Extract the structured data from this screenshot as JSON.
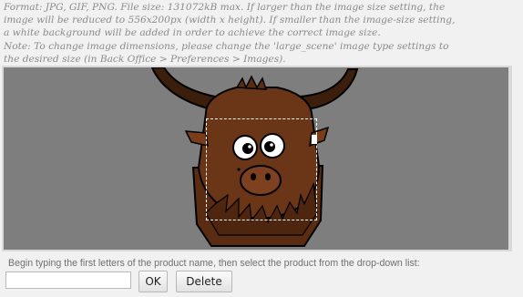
{
  "info": {
    "lines": [
      "Format: JPG, GIF, PNG. File size: 131072kB max. If larger than the image size setting, the",
      "image will be reduced to 556x200px (width x height). If smaller than the image-size setting,",
      "a white background will be added in order to achieve the correct image size.",
      "Note: To change image dimensions, please change the 'large_scene' image type settings to",
      "the desired size (in Back Office > Preferences > Images)."
    ]
  },
  "product_search": {
    "hint": "Begin typing the first letters of the product name, then select the product from the drop-down list:",
    "input_value": "",
    "ok_label": "OK",
    "delete_label": "Delete"
  }
}
